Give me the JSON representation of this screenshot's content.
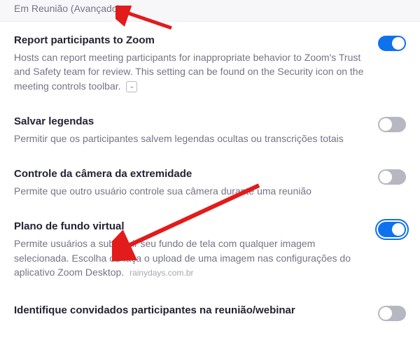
{
  "section_header": "Em Reunião (Avançado)",
  "settings": [
    {
      "title": "Report participants to Zoom",
      "desc": "Hosts can report meeting participants for inappropriate behavior to Zoom's Trust and Safety team for review. This setting can be found on the Security icon on the meeting controls toolbar.",
      "info_icon": "⌄",
      "enabled": true,
      "outlined": false
    },
    {
      "title": "Salvar legendas",
      "desc": "Permitir que os participantes salvem legendas ocultas ou transcrições totais",
      "enabled": false,
      "outlined": false
    },
    {
      "title": "Controle da câmera da extremidade",
      "desc": "Permite que outro usuário controle sua câmera durante uma reunião",
      "enabled": false,
      "outlined": false
    },
    {
      "title": "Plano de fundo virtual",
      "desc": "Permite usuários a substituir seu fundo de tela com qualquer imagem selecionada. Escolha ou faça o upload de uma imagem nas configurações do aplicativo Zoom Desktop.",
      "enabled": true,
      "outlined": true,
      "watermark": "rainydays.com.br"
    },
    {
      "title": "Identifique convidados participantes na reunião/webinar",
      "desc": "",
      "enabled": false,
      "outlined": false
    }
  ],
  "arrows": {
    "color": "#e21b1b"
  }
}
